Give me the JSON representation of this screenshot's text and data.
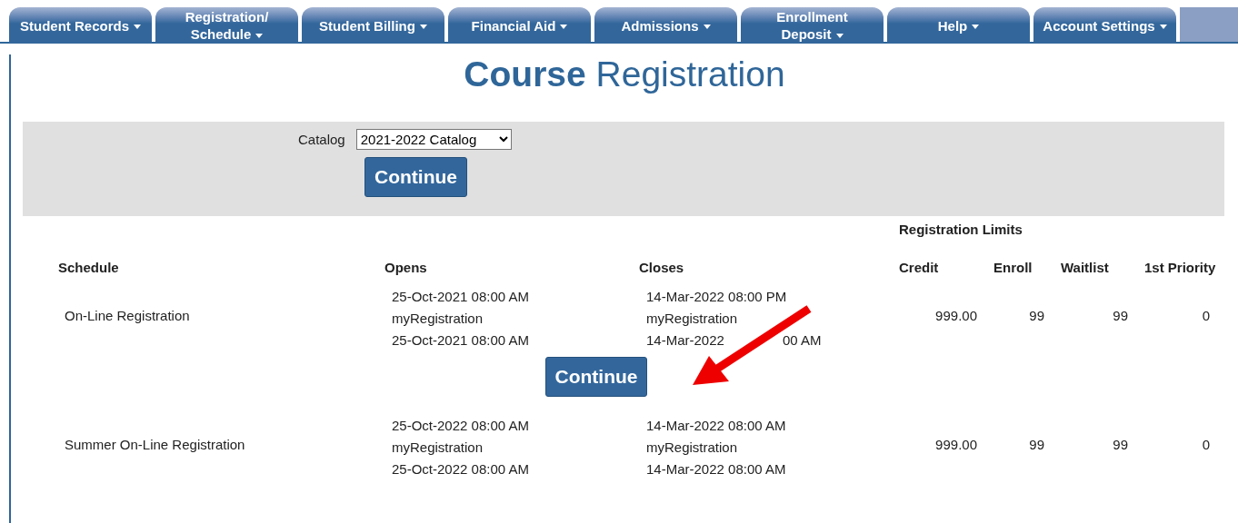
{
  "nav_tabs": [
    {
      "lines": [
        "Student Records"
      ]
    },
    {
      "lines": [
        "Registration/",
        "Schedule"
      ]
    },
    {
      "lines": [
        "Student Billing"
      ]
    },
    {
      "lines": [
        "Financial Aid"
      ]
    },
    {
      "lines": [
        "Admissions"
      ]
    },
    {
      "lines": [
        "Enrollment",
        "Deposit"
      ]
    },
    {
      "lines": [
        "Help"
      ]
    },
    {
      "lines": [
        "Account Settings"
      ]
    }
  ],
  "title": {
    "bold": "Course",
    "rest": "Registration"
  },
  "catalog": {
    "label": "Catalog",
    "value": "2021-2022 Catalog",
    "button": "Continue"
  },
  "table": {
    "group_heading": "Registration Limits",
    "columns": [
      "Schedule",
      "Opens",
      "Closes",
      "Credit",
      "Enroll",
      "Waitlist",
      "1st Priority"
    ],
    "rows": [
      {
        "schedule": "On-Line Registration",
        "opens": [
          "25-Oct-2021 08:00 AM",
          "myRegistration",
          "25-Oct-2021 08:00 AM"
        ],
        "closes": [
          "14-Mar-2022 08:00 PM",
          "myRegistration",
          [
            "14-Mar-2022",
            "00 AM"
          ]
        ],
        "credit": "999.00",
        "enroll": "99",
        "waitlist": "99",
        "priority": "0",
        "button": "Continue"
      },
      {
        "schedule": "Summer On-Line Registration",
        "opens": [
          "25-Oct-2022 08:00 AM",
          "myRegistration",
          "25-Oct-2022 08:00 AM"
        ],
        "closes": [
          "14-Mar-2022 08:00 AM",
          "myRegistration",
          "14-Mar-2022 08:00 AM"
        ],
        "credit": "999.00",
        "enroll": "99",
        "waitlist": "99",
        "priority": "0"
      }
    ]
  }
}
